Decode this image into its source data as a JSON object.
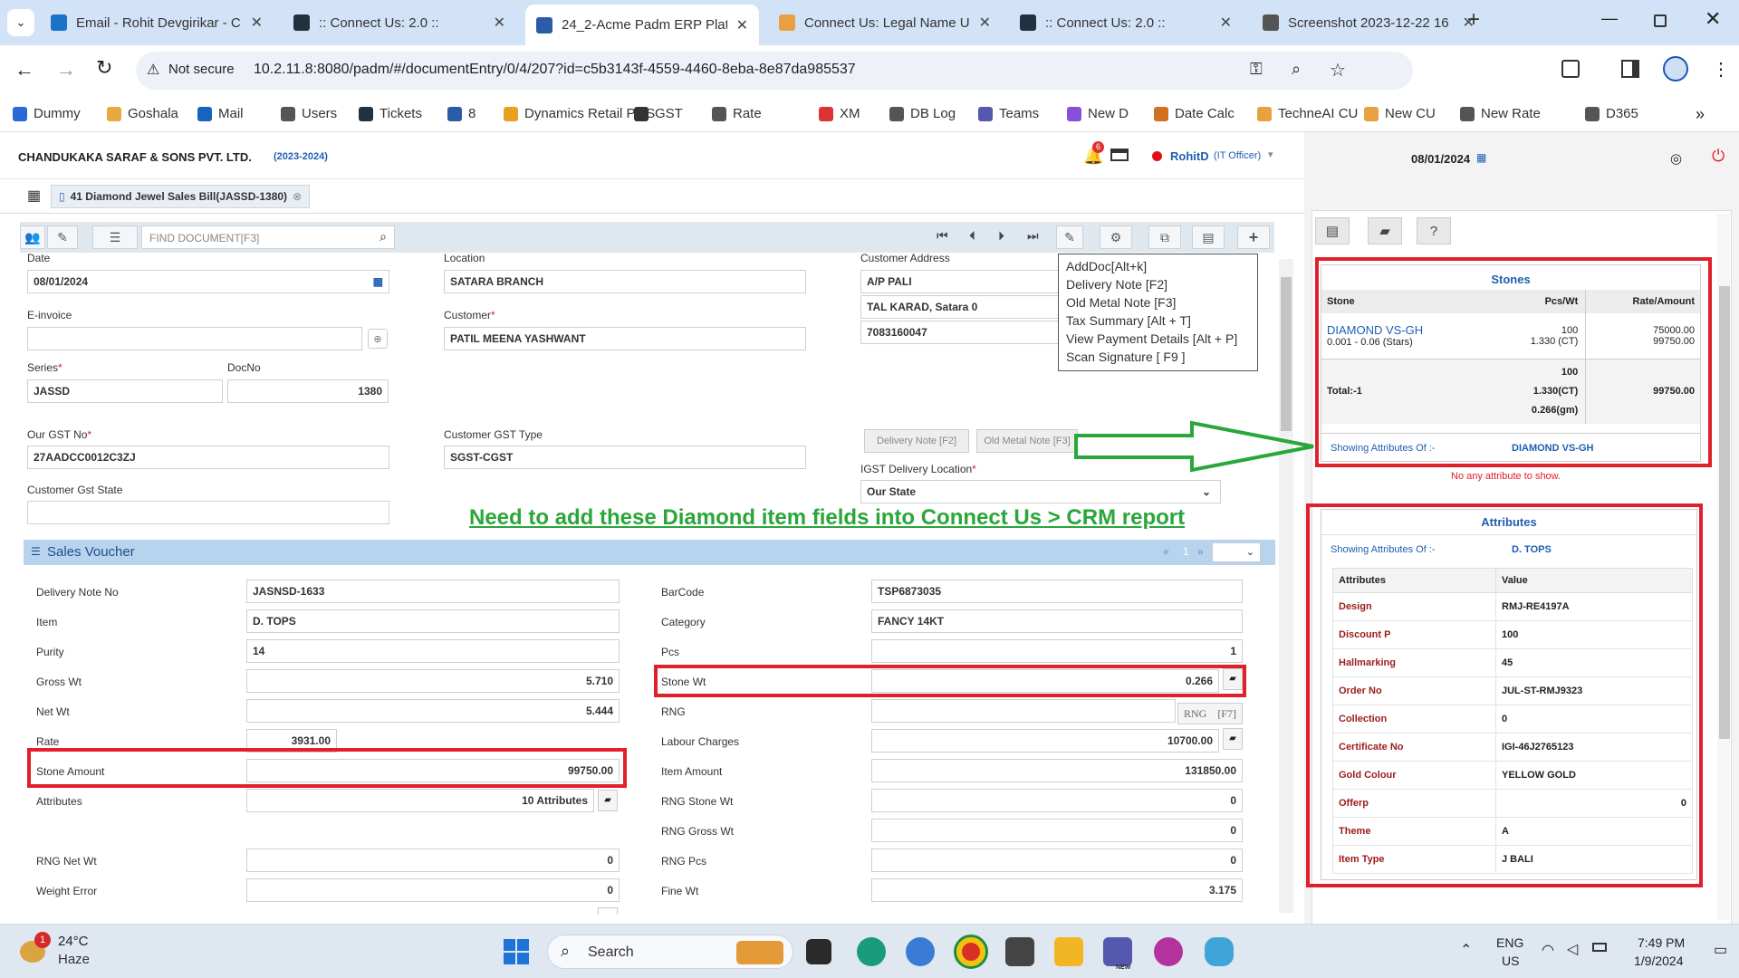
{
  "browser": {
    "tabs": [
      {
        "title": "Email - Rohit Devgirikar - C",
        "color": "#1a73c9"
      },
      {
        "title": ":: Connect Us: 2.0 ::",
        "color": "#22313f"
      },
      {
        "title": "24_2-Acme Padm ERP Platf",
        "color": "#2a5ca8"
      },
      {
        "title": "Connect Us: Legal Name U",
        "color": "#e8a040"
      },
      {
        "title": ":: Connect Us: 2.0 ::",
        "color": "#22313f"
      },
      {
        "title": "Screenshot 2023-12-22 16",
        "color": "#555555"
      }
    ],
    "security": "Not secure",
    "url": "10.2.11.8:8080/padm/#/documentEntry/0/4/207?id=c5b3143f-4559-4460-8eba-8e87da985537",
    "bookmarks": [
      "Dummy",
      "Goshala",
      "Mail",
      "Users",
      "Tickets",
      "8",
      "Dynamics Retail POS",
      "GST",
      "Rate",
      "XM",
      "DB Log",
      "Teams",
      "New D",
      "Date Calc",
      "TechneAI CU",
      "New CU",
      "New Rate",
      "D365"
    ],
    "bookmark_xm_glyph": "XM"
  },
  "app": {
    "company": "CHANDUKAKA SARAF & SONS PVT. LTD.",
    "year": "(2023-2024)",
    "notif_count": "6",
    "user": "RohitD",
    "role": "(IT Officer)",
    "header_date": "08/01/2024",
    "doc_tab": "41 Diamond Jewel Sales Bill(JASSD-1380)",
    "find_placeholder": "FIND DOCUMENT[F3]"
  },
  "menu": {
    "items": [
      "AddDoc[Alt+k]",
      "Delivery Note [F2]",
      "Old Metal Note [F3]",
      "Tax Summary [Alt + T]",
      "View Payment Details [Alt + P]",
      "Scan Signature [ F9 ]"
    ]
  },
  "form": {
    "date_label": "Date",
    "date": "08/01/2024",
    "location_label": "Location",
    "location": "SATARA BRANCH",
    "cust_addr_label": "Customer Address",
    "addr1": "A/P PALI",
    "addr2": "TAL KARAD, Satara 0",
    "phone": "7083160047",
    "einvoice_label": "E-invoice",
    "customer_label": "Customer",
    "customer": "PATIL MEENA YASHWANT",
    "series_label": "Series",
    "series": "JASSD",
    "docno_label": "DocNo",
    "docno": "1380",
    "gstno_label": "Our GST No",
    "gstno": "27AADCC0012C3ZJ",
    "cgsttype_label": "Customer GST Type",
    "cgsttype": "SGST-CGST",
    "gststate_label": "Customer Gst State",
    "btn_delivery": "Delivery Note [F2]",
    "btn_oldmetal": "Old Metal Note [F3]",
    "igst_label": "IGST Delivery Location",
    "igst": "Our State"
  },
  "annotation": "Need to add these Diamond item fields into Connect Us > CRM report",
  "voucher": {
    "title": "Sales Voucher",
    "page": "1",
    "left": [
      {
        "label": "Delivery Note No",
        "value": "JASNSD-1633"
      },
      {
        "label": "Item",
        "value": "D. TOPS"
      },
      {
        "label": "Purity",
        "value": "14"
      },
      {
        "label": "Gross Wt",
        "value": "5.710"
      },
      {
        "label": "Net Wt",
        "value": "5.444"
      },
      {
        "label": "Rate",
        "value": "3931.00"
      },
      {
        "label": "Stone Amount",
        "value": "99750.00"
      },
      {
        "label": "Attributes",
        "value": "10 Attributes"
      },
      {
        "label": "RNG Net Wt",
        "value": "0"
      },
      {
        "label": "Weight Error",
        "value": "0"
      }
    ],
    "right": [
      {
        "label": "BarCode",
        "value": "TSP6873035"
      },
      {
        "label": "Category",
        "value": "FANCY 14KT"
      },
      {
        "label": "Pcs",
        "value": "1"
      },
      {
        "label": "Stone Wt",
        "value": "0.266"
      },
      {
        "label": "RNG",
        "value": ""
      },
      {
        "label": "Labour Charges",
        "value": "10700.00"
      },
      {
        "label": "Item Amount",
        "value": "131850.00"
      },
      {
        "label": "RNG Stone Wt",
        "value": "0"
      },
      {
        "label": "RNG Gross Wt",
        "value": "0"
      },
      {
        "label": "RNG Pcs",
        "value": "0"
      },
      {
        "label": "Fine Wt",
        "value": "3.175"
      }
    ],
    "rng_btn": "RNG",
    "rng_key": "[F7]"
  },
  "stones": {
    "title": "Stones",
    "headers": [
      "Stone",
      "Pcs/Wt",
      "Rate/Amount"
    ],
    "row": {
      "name": "DIAMOND VS-GH",
      "sub": "0.001 - 0.06 (Stars)",
      "pcs": "100",
      "wt": "1.330 (CT)",
      "rate": "75000.00",
      "amount": "99750.00"
    },
    "total_label": "Total:-1",
    "total_pcs": "100",
    "total_ct": "1.330(CT)",
    "total_gm": "0.266(gm)",
    "total_amt": "99750.00",
    "showing_label": "Showing Attributes Of :-",
    "showing_value": "DIAMOND VS-GH",
    "no_attr": "No any attribute to show."
  },
  "attributes": {
    "title": "Attributes",
    "showing_label": "Showing Attributes Of :-",
    "showing_value": "D. TOPS",
    "headers": [
      "Attributes",
      "Value"
    ],
    "rows": [
      {
        "name": "Design",
        "value": "RMJ-RE4197A"
      },
      {
        "name": "Discount P",
        "value": "100"
      },
      {
        "name": "Hallmarking",
        "value": "45"
      },
      {
        "name": "Order No",
        "value": "JUL-ST-RMJ9323"
      },
      {
        "name": "Collection",
        "value": "0"
      },
      {
        "name": "Certificate No",
        "value": "IGI-46J2765123"
      },
      {
        "name": "Gold Colour",
        "value": "YELLOW GOLD"
      },
      {
        "name": "Offerp",
        "value": "0"
      },
      {
        "name": "Theme",
        "value": "A"
      },
      {
        "name": "Item Type",
        "value": "J BALI"
      }
    ]
  },
  "taskbar": {
    "weather_badge": "1",
    "temp": "24°C",
    "cond": "Haze",
    "search": "Search",
    "new_badge": "NEW",
    "lang1": "ENG",
    "lang2": "US",
    "time": "7:49 PM",
    "date": "1/9/2024"
  },
  "colors": {
    "accent": "#1f5fb0",
    "red": "#e0202a",
    "green": "#2aa63a",
    "maroon": "#9b1c1c"
  }
}
